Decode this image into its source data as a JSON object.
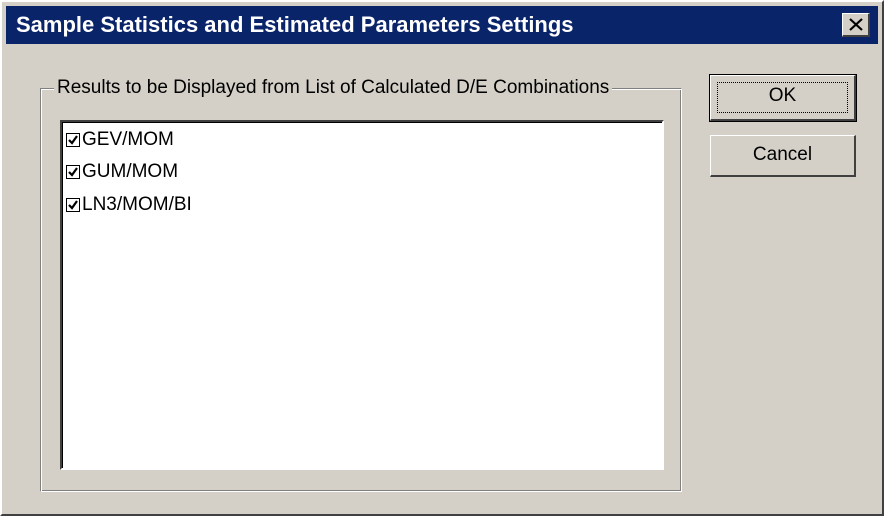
{
  "window": {
    "title": "Sample Statistics and Estimated Parameters Settings",
    "close_icon": "close-icon"
  },
  "group": {
    "label": "Results to be Displayed from List of Calculated D/E Combinations",
    "items": [
      {
        "label": "GEV/MOM",
        "checked": true
      },
      {
        "label": "GUM/MOM",
        "checked": true
      },
      {
        "label": "LN3/MOM/BI",
        "checked": true
      }
    ]
  },
  "buttons": {
    "ok_label": "OK",
    "cancel_label": "Cancel"
  },
  "colors": {
    "titlebar": "#0a246a",
    "face": "#d4d0c8"
  }
}
